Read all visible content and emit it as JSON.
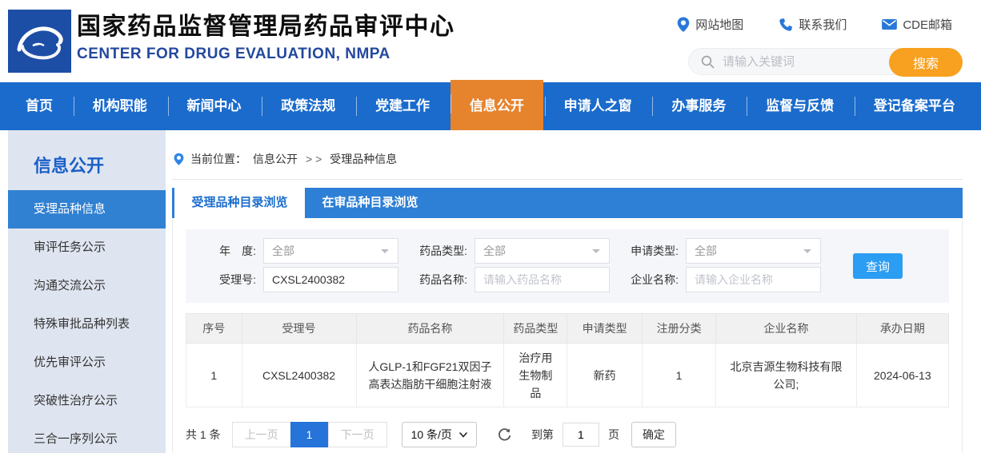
{
  "header": {
    "title": "国家药品监督管理局药品审评中心",
    "subtitle": "CENTER FOR DRUG EVALUATION, NMPA",
    "links": [
      {
        "icon": "location-pin-icon",
        "label": "网站地图"
      },
      {
        "icon": "phone-icon",
        "label": "联系我们"
      },
      {
        "icon": "envelope-icon",
        "label": "CDE邮箱"
      }
    ],
    "search": {
      "placeholder": "请输入关键词",
      "button_label": "搜索"
    }
  },
  "nav": {
    "items": [
      {
        "label": "首页",
        "active": false
      },
      {
        "label": "机构职能",
        "active": false
      },
      {
        "label": "新闻中心",
        "active": false
      },
      {
        "label": "政策法规",
        "active": false
      },
      {
        "label": "党建工作",
        "active": false
      },
      {
        "label": "信息公开",
        "active": true
      },
      {
        "label": "申请人之窗",
        "active": false
      },
      {
        "label": "办事服务",
        "active": false
      },
      {
        "label": "监督与反馈",
        "active": false
      },
      {
        "label": "登记备案平台",
        "active": false
      }
    ]
  },
  "sidebar": {
    "title": "信息公开",
    "items": [
      {
        "label": "受理品种信息",
        "active": true
      },
      {
        "label": "审评任务公示",
        "active": false
      },
      {
        "label": "沟通交流公示",
        "active": false
      },
      {
        "label": "特殊审批品种列表",
        "active": false
      },
      {
        "label": "优先审评公示",
        "active": false
      },
      {
        "label": "突破性治疗公示",
        "active": false
      },
      {
        "label": "三合一序列公示",
        "active": false
      }
    ]
  },
  "breadcrumb": {
    "prefix": "当前位置：",
    "section": "信息公开",
    "separator": "> >",
    "current": "受理品种信息"
  },
  "tabs": [
    {
      "label": "受理品种目录浏览",
      "active": true
    },
    {
      "label": "在审品种目录浏览",
      "active": false
    }
  ],
  "filters": {
    "year": {
      "label": "年　度:",
      "value": "全部"
    },
    "drug_type": {
      "label": "药品类型:",
      "value": "全部"
    },
    "apply_type": {
      "label": "申请类型:",
      "value": "全部"
    },
    "accept_no": {
      "label": "受理号:",
      "value": "CXSL2400382"
    },
    "drug_name": {
      "label": "药品名称:",
      "placeholder": "请输入药品名称"
    },
    "company": {
      "label": "企业名称:",
      "placeholder": "请输入企业名称"
    },
    "query_button": "查询"
  },
  "table": {
    "headers": [
      "序号",
      "受理号",
      "药品名称",
      "药品类型",
      "申请类型",
      "注册分类",
      "企业名称",
      "承办日期"
    ],
    "rows": [
      [
        "1",
        "CXSL2400382",
        "人GLP-1和FGF21双因子高表达脂肪干细胞注射液",
        "治疗用生物制品",
        "新药",
        "1",
        "北京吉源生物科技有限公司;",
        "2024-06-13"
      ]
    ]
  },
  "pagination": {
    "total": "共 1 条",
    "prev": "上一页",
    "page": "1",
    "next": "下一页",
    "page_size": "10 条/页",
    "goto_label": "到第",
    "goto_value": "1",
    "goto_unit": "页",
    "confirm": "确定"
  },
  "colors": {
    "nav_blue": "#1a6bcc",
    "tab_blue": "#2e7fd6",
    "active_orange": "#e6842e",
    "search_orange": "#f8a120",
    "query_blue": "#2b9df3",
    "sidebar_bg": "#dfe5f0",
    "sidebar_active_blue": "#3181d2",
    "page_active_blue": "#2673d9",
    "logo_blue": "#1d4ea6"
  }
}
